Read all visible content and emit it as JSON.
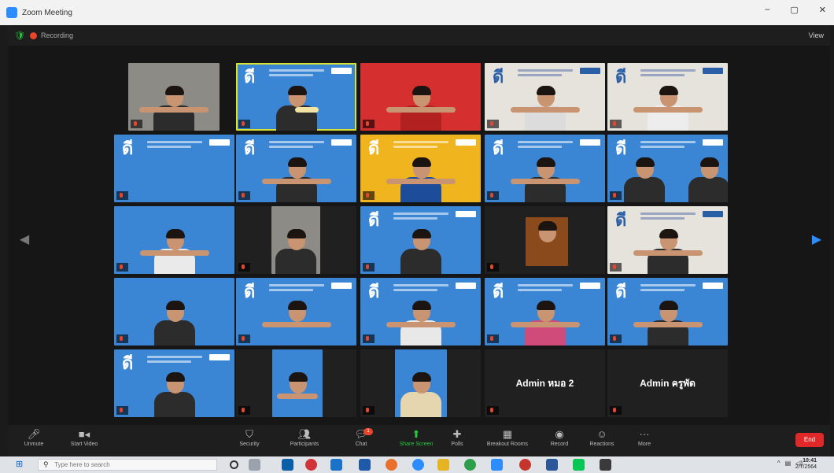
{
  "window": {
    "title": "Zoom Meeting",
    "controls": [
      "–",
      "▢",
      "✕"
    ]
  },
  "meeting_top": {
    "recording_label": "Recording",
    "view_label": "View"
  },
  "admins": [
    {
      "name": "Admin หมอ 2"
    },
    {
      "name": "Admin ครูพัด"
    }
  ],
  "toolbar": {
    "buttons": [
      {
        "label": "Unmute",
        "icon": "microphone-icon"
      },
      {
        "label": "Start Video",
        "icon": "video-camera-icon"
      },
      {
        "label": "Security",
        "icon": "shield-icon"
      },
      {
        "label": "Participants",
        "icon": "participants-icon",
        "badge": "28"
      },
      {
        "label": "Chat",
        "icon": "chat-icon",
        "badge": "1"
      },
      {
        "label": "Share Screen",
        "icon": "share-screen-icon"
      },
      {
        "label": "Polls",
        "icon": "polls-icon"
      },
      {
        "label": "Breakout Rooms",
        "icon": "breakout-rooms-icon"
      },
      {
        "label": "Record",
        "icon": "record-icon"
      },
      {
        "label": "Reactions",
        "icon": "reactions-icon"
      },
      {
        "label": "More",
        "icon": "more-icon"
      }
    ],
    "end_label": "End"
  },
  "taskbar": {
    "search_placeholder": "Type here to search",
    "time": "10:41",
    "date": "2/7/2564"
  },
  "colors": {
    "zoom_blue": "#2d8cff",
    "active_speaker": "#d8e232",
    "end_red": "#e02828",
    "tile_blue": "#3b86d4"
  }
}
